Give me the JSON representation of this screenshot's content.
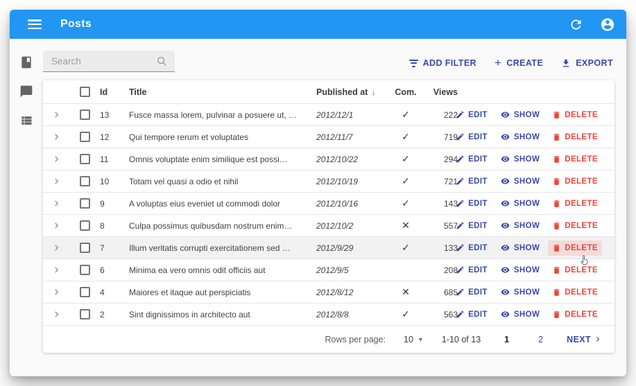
{
  "appbar": {
    "title": "Posts"
  },
  "search": {
    "placeholder": "Search"
  },
  "toolbar": {
    "add_filter": "ADD FILTER",
    "create": "CREATE",
    "export": "EXPORT"
  },
  "sidebar": {
    "items": [
      {
        "icon": "book-icon",
        "name": "posts"
      },
      {
        "icon": "comment-icon",
        "name": "comments"
      },
      {
        "icon": "list-icon",
        "name": "list"
      }
    ]
  },
  "table": {
    "headers": {
      "id": "Id",
      "title": "Title",
      "published": "Published at",
      "com": "Com.",
      "views": "Views"
    },
    "actions": {
      "edit": "EDIT",
      "show": "SHOW",
      "delete": "DELETE"
    },
    "rows": [
      {
        "id": "13",
        "title": "Fusce massa lorem, pulvinar a posuere ut, …",
        "published": "2012/12/1",
        "com": "check",
        "views": "222",
        "hovered": false
      },
      {
        "id": "12",
        "title": "Qui tempore rerum et voluptates",
        "published": "2012/11/7",
        "com": "check",
        "views": "719",
        "hovered": false
      },
      {
        "id": "11",
        "title": "Omnis voluptate enim similique est possi…",
        "published": "2012/10/22",
        "com": "check",
        "views": "294",
        "hovered": false
      },
      {
        "id": "10",
        "title": "Totam vel quasi a odio et nihil",
        "published": "2012/10/19",
        "com": "check",
        "views": "721",
        "hovered": false
      },
      {
        "id": "9",
        "title": "A voluptas eius eveniet ut commodi dolor",
        "published": "2012/10/16",
        "com": "check",
        "views": "143",
        "hovered": false
      },
      {
        "id": "8",
        "title": "Culpa possimus quibusdam nostrum enim…",
        "published": "2012/10/2",
        "com": "cross",
        "views": "557",
        "hovered": false
      },
      {
        "id": "7",
        "title": "Illum veritatis corrupti exercitationem sed …",
        "published": "2012/9/29",
        "com": "check",
        "views": "133",
        "hovered": true
      },
      {
        "id": "6",
        "title": "Minima ea vero omnis odit officiis aut",
        "published": "2012/9/5",
        "com": "none",
        "views": "208",
        "hovered": false
      },
      {
        "id": "4",
        "title": "Maiores et itaque aut perspiciatis",
        "published": "2012/8/12",
        "com": "cross",
        "views": "685",
        "hovered": false
      },
      {
        "id": "2",
        "title": "Sint dignissimos in architecto aut",
        "published": "2012/8/8",
        "com": "check",
        "views": "563",
        "hovered": false
      }
    ],
    "com_glyphs": {
      "check": "✓",
      "cross": "✕",
      "none": ""
    }
  },
  "pagination": {
    "rows_per_page_label": "Rows per page:",
    "rows_per_page_value": "10",
    "range": "1-10 of 13",
    "page1": "1",
    "page2": "2",
    "next": "NEXT"
  },
  "colors": {
    "appbar": "#2196f3",
    "primary": "#3949ab",
    "danger": "#f44336"
  }
}
